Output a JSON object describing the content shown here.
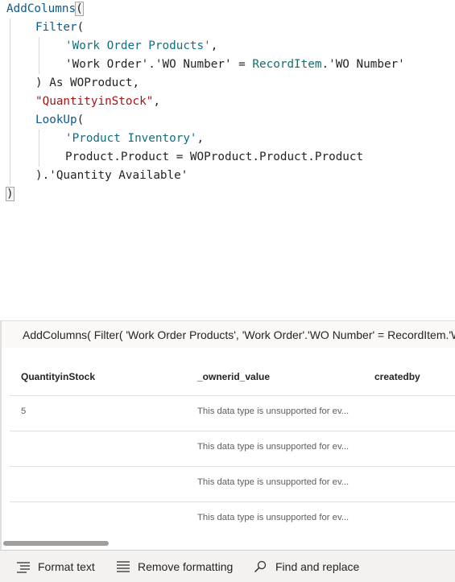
{
  "editor": {
    "lines": [
      {
        "parts": [
          {
            "t": "AddColumns",
            "c": "fn"
          },
          {
            "t": "(",
            "c": "bracket"
          }
        ]
      },
      {
        "parts": [
          {
            "t": "Filter",
            "c": "fn"
          },
          {
            "t": "(",
            "c": ""
          }
        ]
      },
      {
        "parts": [
          {
            "t": "'Work Order Products'",
            "c": "tbl"
          },
          {
            "t": ",",
            "c": ""
          }
        ]
      },
      {
        "parts": [
          {
            "t": "'Work Order'.'WO Number' = ",
            "c": ""
          },
          {
            "t": "RecordItem",
            "c": "ident"
          },
          {
            "t": ".'WO Number'",
            "c": ""
          }
        ]
      },
      {
        "parts": [
          {
            "t": ") As WOProduct,",
            "c": ""
          }
        ]
      },
      {
        "parts": [
          {
            "t": "\"QuantityinStock\"",
            "c": "str"
          },
          {
            "t": ",",
            "c": ""
          }
        ]
      },
      {
        "parts": [
          {
            "t": "LookUp",
            "c": "fn"
          },
          {
            "t": "(",
            "c": ""
          }
        ]
      },
      {
        "parts": [
          {
            "t": "'Product Inventory'",
            "c": "tbl"
          },
          {
            "t": ",",
            "c": ""
          }
        ]
      },
      {
        "parts": [
          {
            "t": "Product.Product = WOProduct.Product.Product",
            "c": ""
          }
        ]
      },
      {
        "parts": [
          {
            "t": ").'Quantity Available'",
            "c": ""
          }
        ]
      },
      {
        "parts": [
          {
            "t": ")",
            "c": "bracket"
          }
        ]
      }
    ]
  },
  "preview": {
    "text": "AddColumns( Filter( 'Work Order Products', 'Work Order'.'WO Number' = RecordItem.'WO Number' ) As WOProduct, \"QuantityinStock\", LookUp( 'Product Inventory', Product.Product = WOProduct.Product.Product ).'Quantity Available' )"
  },
  "grid": {
    "headers": [
      "QuantityinStock",
      "_ownerid_value",
      "createdby"
    ],
    "rows": [
      [
        "5",
        "This data type is unsupported for ev...",
        ""
      ],
      [
        "",
        "This data type is unsupported for ev...",
        ""
      ],
      [
        "",
        "This data type is unsupported for ev...",
        ""
      ],
      [
        "",
        "This data type is unsupported for ev...",
        ""
      ]
    ]
  },
  "toolbar": {
    "format_text": "Format text",
    "remove_formatting": "Remove formatting",
    "find_replace": "Find and replace"
  },
  "icons": {
    "collapse": "chevron-up-icon",
    "format": "format-text-icon",
    "remove": "remove-formatting-icon",
    "find": "search-icon"
  }
}
